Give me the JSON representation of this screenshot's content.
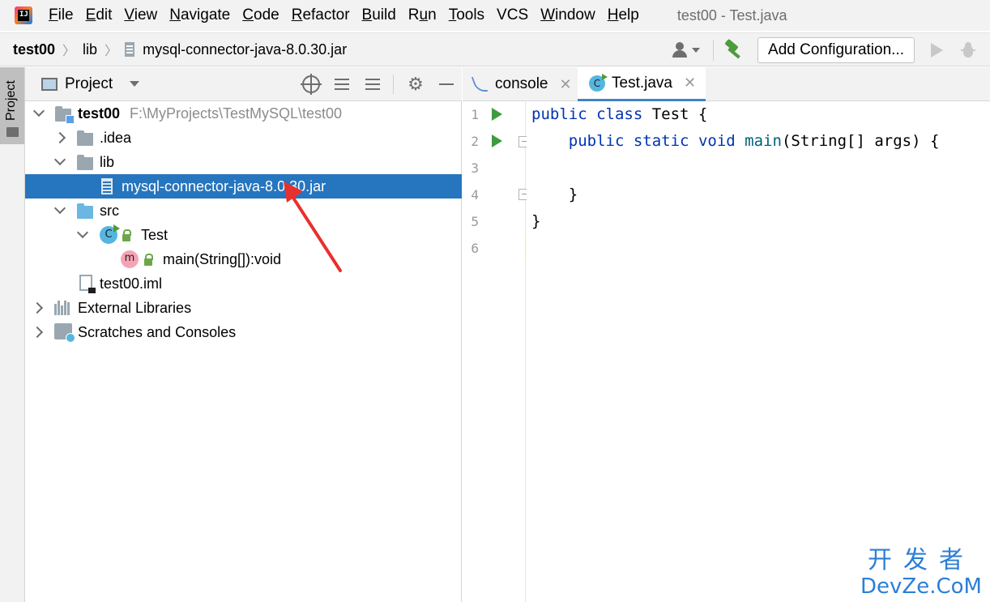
{
  "app": {
    "logo_text": "IJ",
    "window_title": "test00 - Test.java"
  },
  "menu": {
    "items": [
      {
        "mnemonic": "F",
        "rest": "ile"
      },
      {
        "mnemonic": "E",
        "rest": "dit"
      },
      {
        "mnemonic": "V",
        "rest": "iew"
      },
      {
        "mnemonic": "N",
        "rest": "avigate"
      },
      {
        "mnemonic": "C",
        "rest": "ode"
      },
      {
        "mnemonic": "R",
        "rest": "efactor"
      },
      {
        "mnemonic": "B",
        "rest": "uild"
      },
      {
        "mnemonic": "",
        "pre": "R",
        "mid": "u",
        "post": "n"
      },
      {
        "mnemonic": "T",
        "rest": "ools"
      },
      {
        "mnemonic": "",
        "plain": "VCS"
      },
      {
        "mnemonic": "W",
        "rest": "indow"
      },
      {
        "mnemonic": "H",
        "rest": "elp"
      }
    ]
  },
  "breadcrumb": {
    "items": [
      "test00",
      "lib",
      "mysql-connector-java-8.0.30.jar"
    ]
  },
  "toolbar": {
    "config_label": "Add Configuration..."
  },
  "toolstrip": {
    "project_tab": "Project"
  },
  "project_panel": {
    "title": "Project"
  },
  "tree": {
    "root_name": "test00",
    "root_path": "F:\\MyProjects\\TestMySQL\\test00",
    "idea": ".idea",
    "lib": "lib",
    "jar": "mysql-connector-java-8.0.30.jar",
    "src": "src",
    "test_class": "Test",
    "main_method": "main(String[]):void",
    "iml": "test00.iml",
    "external_libraries": "External Libraries",
    "scratches": "Scratches and Consoles"
  },
  "editor": {
    "tabs": [
      {
        "label": "console",
        "active": false
      },
      {
        "label": "Test.java",
        "active": true
      }
    ],
    "line_numbers": [
      "1",
      "2",
      "3",
      "4",
      "5",
      "6"
    ],
    "code": {
      "l1_kw1": "public",
      "l1_kw2": "class",
      "l1_rest": " Test {",
      "l2_kw1": "public",
      "l2_kw2": "static",
      "l2_kw3": "void",
      "l2_fn": "main",
      "l2_rest": "(String[] args) {",
      "l4": "    }",
      "l5": "}"
    }
  },
  "watermark": {
    "cn": "开发者",
    "en": "DevZe.CoM"
  },
  "colors": {
    "selection": "#2675bf",
    "keyword": "#0033b3",
    "run_green": "#3f9b3f",
    "arrow_red": "#e8302e"
  }
}
